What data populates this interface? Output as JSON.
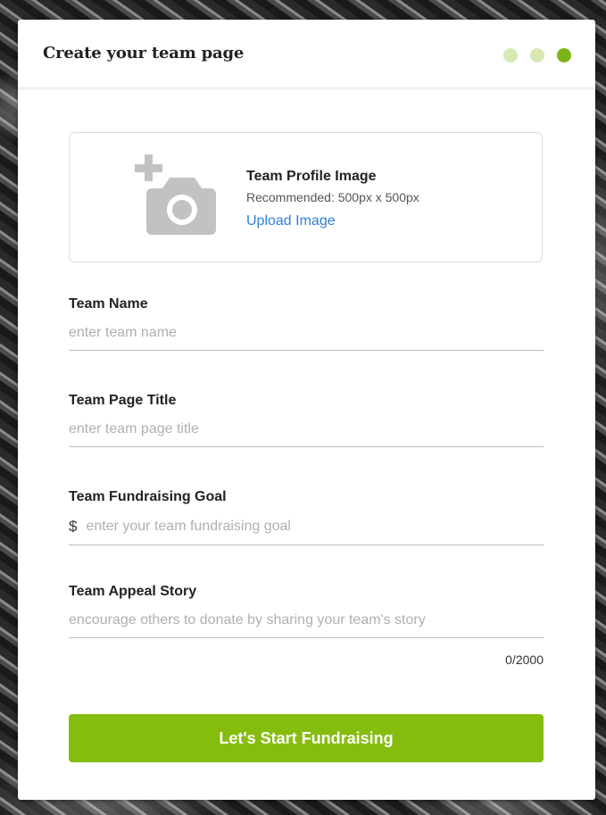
{
  "header": {
    "title": "Create your team page",
    "steps": [
      {
        "state": "inactive",
        "color": "#d6e9b3"
      },
      {
        "state": "inactive",
        "color": "#d6e9b3"
      },
      {
        "state": "active",
        "color": "#7cb518"
      }
    ]
  },
  "upload": {
    "title": "Team Profile Image",
    "hint": "Recommended: 500px x 500px",
    "link_label": "Upload Image",
    "icon": "add-photo-camera-icon"
  },
  "fields": {
    "team_name": {
      "label": "Team Name",
      "value": "",
      "placeholder": "enter team name"
    },
    "page_title": {
      "label": "Team Page Title",
      "value": "",
      "placeholder": "enter team page title"
    },
    "goal": {
      "label": "Team Fundraising Goal",
      "currency": "$",
      "value": "",
      "placeholder": "enter your team fundraising goal"
    },
    "story": {
      "label": "Team Appeal Story",
      "value": "",
      "placeholder": "encourage others to donate by sharing your team's story",
      "counter": "0/2000"
    }
  },
  "cta": {
    "label": "Let's Start Fundraising",
    "color": "#85bd0f"
  }
}
